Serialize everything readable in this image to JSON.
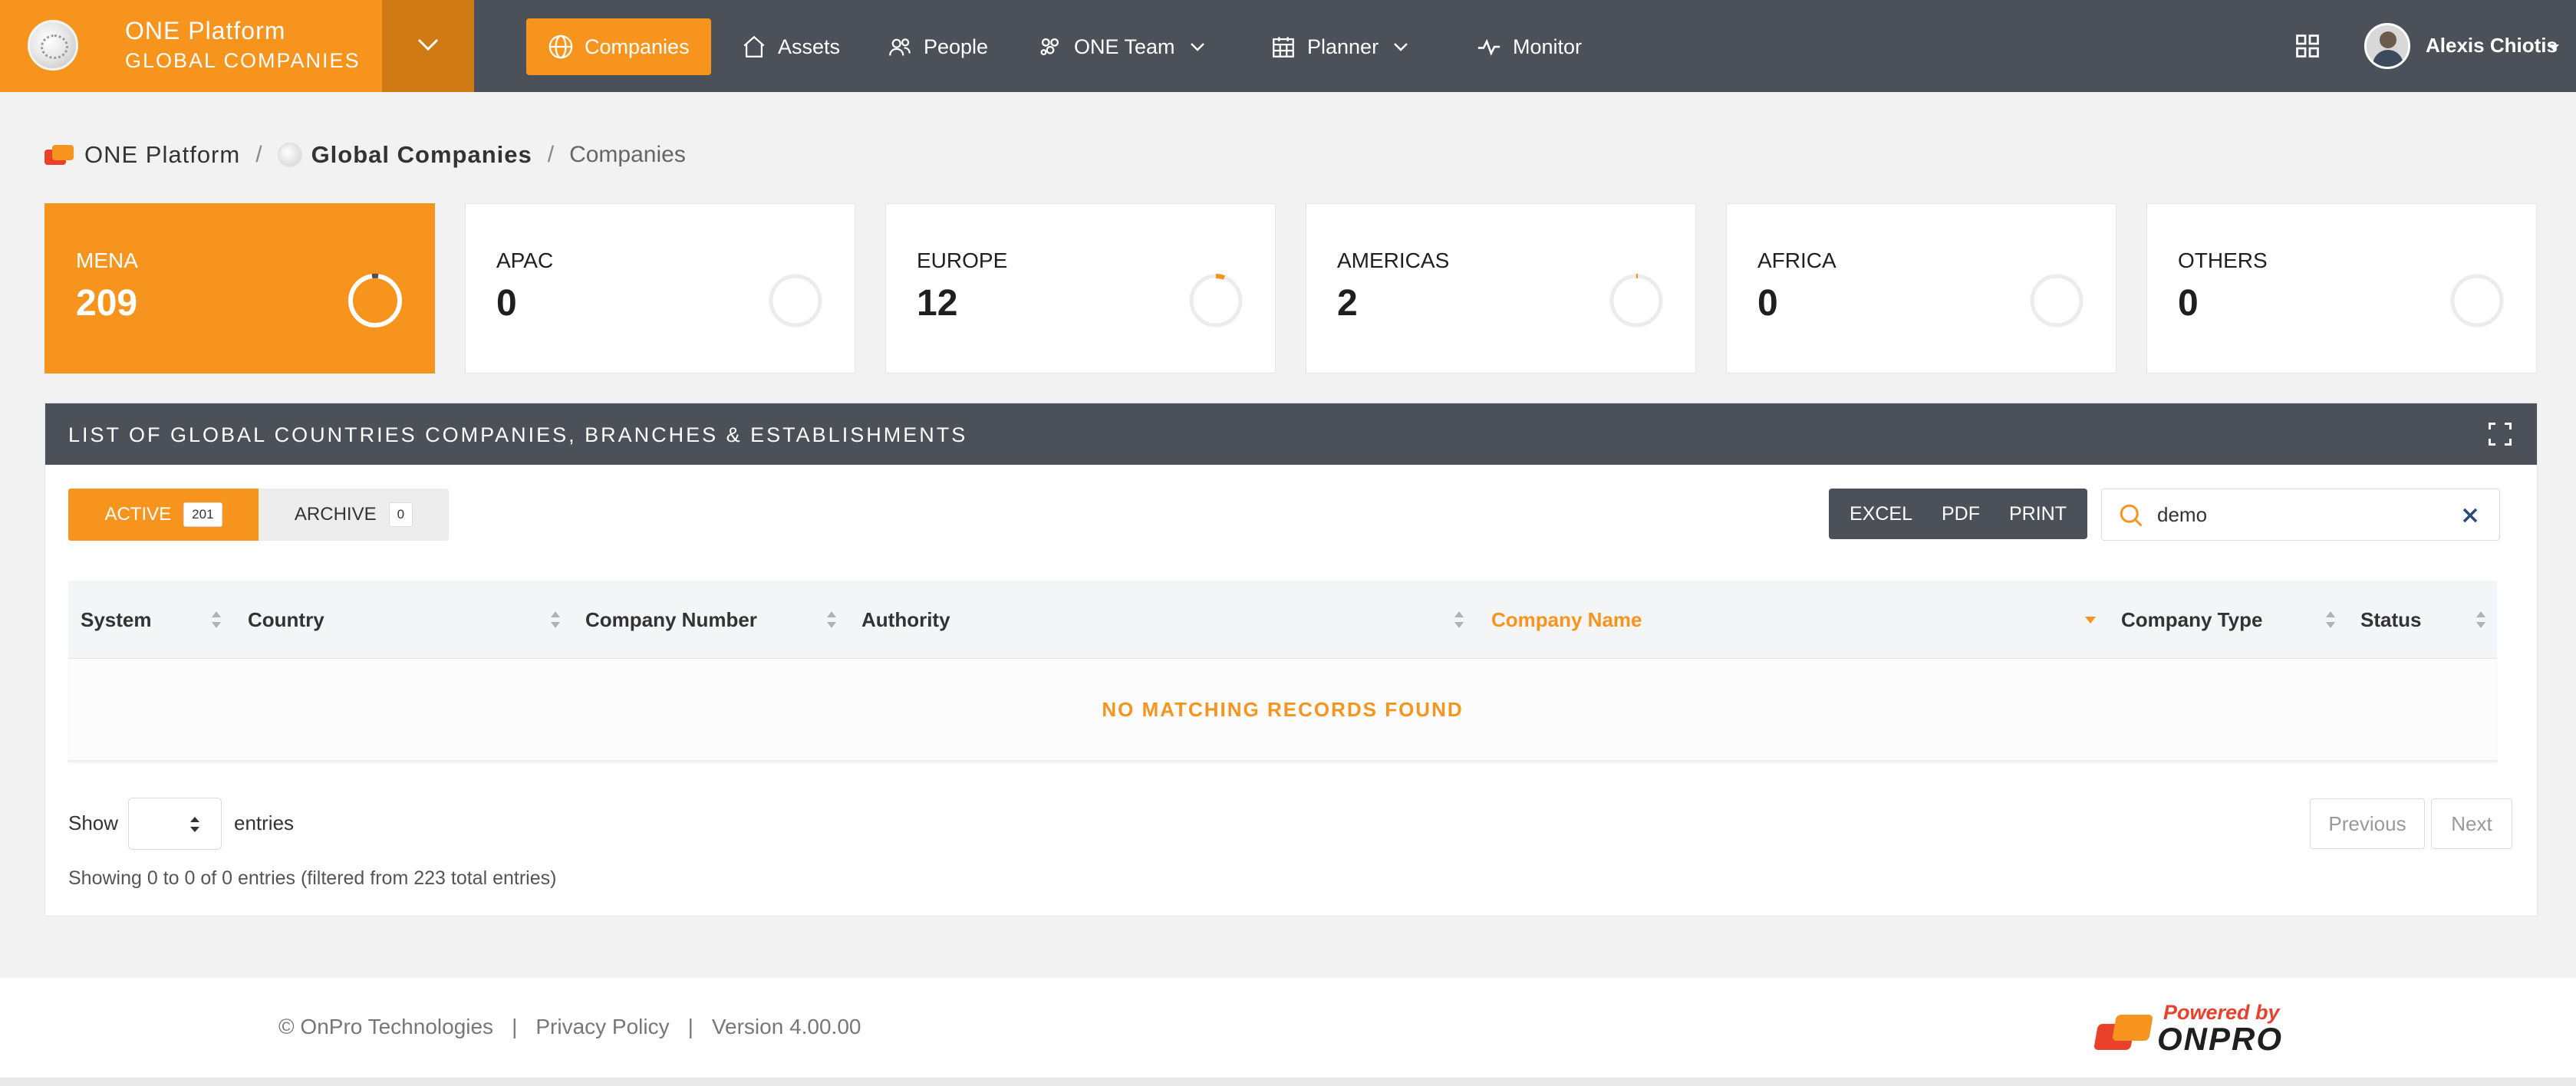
{
  "brand": {
    "title": "ONE Platform",
    "subtitle": "GLOBAL COMPANIES"
  },
  "nav": {
    "items": [
      {
        "label": "Companies",
        "icon": "globe-icon",
        "active": true
      },
      {
        "label": "Assets",
        "icon": "home-icon"
      },
      {
        "label": "People",
        "icon": "people-icon"
      },
      {
        "label": "ONE Team",
        "icon": "team-icon",
        "dropdown": true
      },
      {
        "label": "Planner",
        "icon": "calendar-icon",
        "dropdown": true
      },
      {
        "label": "Monitor",
        "icon": "pulse-icon"
      }
    ]
  },
  "user": {
    "name": "Alexis Chiotis"
  },
  "breadcrumb": {
    "root": "ONE Platform",
    "section": "Global Companies",
    "current": "Companies",
    "separator": "/"
  },
  "regions": [
    {
      "label": "MENA",
      "value": "209",
      "active": true
    },
    {
      "label": "APAC",
      "value": "0"
    },
    {
      "label": "EUROPE",
      "value": "12"
    },
    {
      "label": "AMERICAS",
      "value": "2"
    },
    {
      "label": "AFRICA",
      "value": "0"
    },
    {
      "label": "OTHERS",
      "value": "0"
    }
  ],
  "panel": {
    "title": "LIST OF GLOBAL COUNTRIES COMPANIES, BRANCHES & ESTABLISHMENTS",
    "tabs": [
      {
        "label": "ACTIVE",
        "count": "201"
      },
      {
        "label": "ARCHIVE",
        "count": "0"
      }
    ],
    "export": [
      "EXCEL",
      "PDF",
      "PRINT"
    ],
    "search": {
      "value": "demo"
    },
    "columns": [
      "System",
      "Country",
      "Company Number",
      "Authority",
      "Company Name",
      "Company Type",
      "Status"
    ],
    "sorted_column": "Company Name",
    "empty_message": "NO MATCHING RECORDS FOUND",
    "show_label": "Show",
    "entries_label": "entries",
    "pager": {
      "previous": "Previous",
      "next": "Next"
    },
    "info": "Showing 0 to 0 of 0 entries (filtered from 223 total entries)"
  },
  "footer": {
    "copyright": "© OnPro Technologies",
    "privacy": "Privacy Policy",
    "version": "Version 4.00.00",
    "separator": "|",
    "powered_by": "Powered by",
    "logo_word": "ONPRO"
  },
  "colors": {
    "accent": "#f7941d",
    "dark": "#4b5059",
    "logo_red": "#e8412c"
  }
}
